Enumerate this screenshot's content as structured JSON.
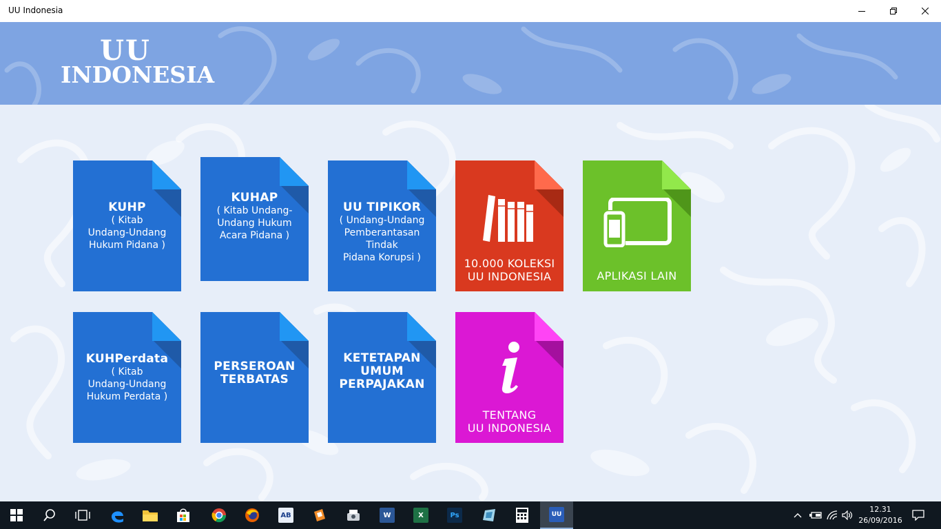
{
  "window": {
    "title": "UU Indonesia",
    "controls": [
      "minimize",
      "restore",
      "close"
    ]
  },
  "header": {
    "logo_line1": "UU",
    "logo_line2": "INDONESIA",
    "background": "#7ea4e2"
  },
  "tiles": [
    {
      "id": "kuhp",
      "title": "KUHP",
      "subtitle": [
        "( Kitab",
        "Undang-Undang",
        "Hukum Pidana )"
      ],
      "color": "#2370d3",
      "fold": "#2196f3"
    },
    {
      "id": "kuhap",
      "title": "KUHAP",
      "subtitle": [
        "( Kitab Undang-",
        "Undang Hukum",
        "Acara Pidana )"
      ],
      "color": "#2370d3",
      "fold": "#2196f3"
    },
    {
      "id": "uu-tipikor",
      "title": "UU TIPIKOR",
      "subtitle": [
        "( Undang-Undang",
        "Pemberantasan",
        "Tindak",
        "Pidana Korupsi )"
      ],
      "color": "#2370d3",
      "fold": "#2196f3"
    },
    {
      "id": "koleksi",
      "caption": [
        "10.000 KOLEKSI",
        "UU INDONESIA"
      ],
      "icon": "books-icon",
      "color": "#d9391f",
      "fold": "#ff6a4c"
    },
    {
      "id": "aplikasi-lain",
      "caption": [
        "APLIKASI LAIN"
      ],
      "icon": "devices-icon",
      "color": "#6cc12a",
      "fold": "#92e84b"
    },
    {
      "id": "kuhperdata",
      "title": "KUHPerdata",
      "subtitle": [
        "( Kitab",
        "Undang-Undang",
        "Hukum Perdata )"
      ],
      "color": "#2370d3",
      "fold": "#2196f3"
    },
    {
      "id": "perseroan-terbatas",
      "title_lines": [
        "PERSEROAN",
        "TERBATAS"
      ],
      "color": "#2370d3",
      "fold": "#2196f3"
    },
    {
      "id": "ketetapan-umum",
      "title_lines": [
        "KETETAPAN",
        "UMUM",
        "PERPAJAKAN"
      ],
      "color": "#2370d3",
      "fold": "#2196f3"
    },
    {
      "id": "tentang",
      "caption": [
        "TENTANG",
        "UU INDONESIA"
      ],
      "icon": "info-icon",
      "color": "#db18d4",
      "fold": "#ff44f5"
    }
  ],
  "taskbar": {
    "apps": [
      {
        "name": "start",
        "icon": "windows-icon"
      },
      {
        "name": "search",
        "icon": "search-icon"
      },
      {
        "name": "task-view",
        "icon": "task-view-icon"
      },
      {
        "name": "edge",
        "icon": "edge-icon"
      },
      {
        "name": "file-explorer",
        "icon": "folder-icon"
      },
      {
        "name": "store",
        "icon": "store-icon"
      },
      {
        "name": "chrome",
        "icon": "chrome-icon"
      },
      {
        "name": "firefox",
        "icon": "firefox-icon"
      },
      {
        "name": "app-ab",
        "icon": "ab-icon",
        "label": "AB"
      },
      {
        "name": "app-orange",
        "icon": "orange-app-icon"
      },
      {
        "name": "app-scanner",
        "icon": "scanner-icon"
      },
      {
        "name": "word",
        "icon": "word-icon",
        "label": "W"
      },
      {
        "name": "excel",
        "icon": "excel-icon",
        "label": "X"
      },
      {
        "name": "photoshop",
        "icon": "photoshop-icon",
        "label": "Ps"
      },
      {
        "name": "app-blue",
        "icon": "blue-app-icon"
      },
      {
        "name": "calculator",
        "icon": "calculator-icon"
      },
      {
        "name": "uu-indonesia",
        "icon": "uu-indonesia-icon",
        "label": "UU",
        "active": true
      }
    ],
    "clock_time": "12.31",
    "clock_date": "26/09/2016"
  }
}
